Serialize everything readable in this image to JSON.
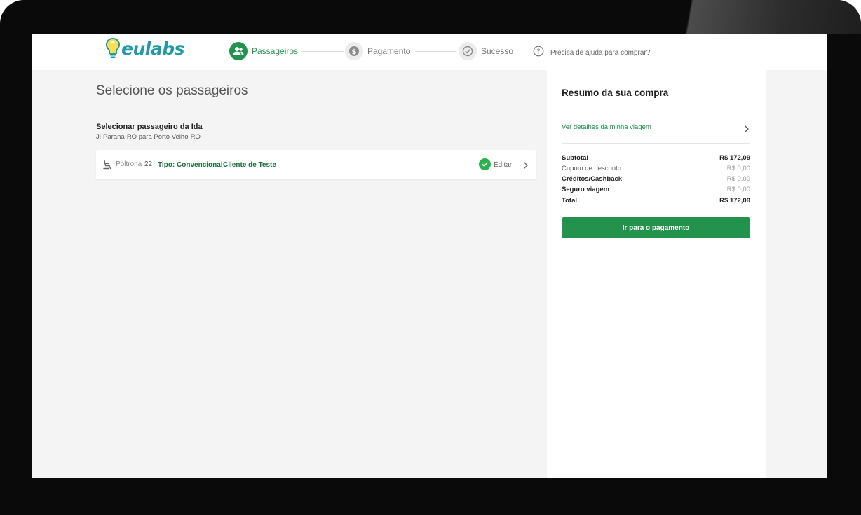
{
  "brand": {
    "logo_text": "eulabs"
  },
  "steps": [
    {
      "label": "Passageiros",
      "active": true
    },
    {
      "label": "Pagamento",
      "active": false
    },
    {
      "label": "Sucesso",
      "active": false
    }
  ],
  "help": {
    "label": "Precisa de ajuda para comprar?"
  },
  "main": {
    "title": "Selecione os passageiros",
    "section_title": "Selecionar passageiro da Ida",
    "route": "Ji-Paraná-RO para Porto Velho-RO",
    "passenger": {
      "seat_label": "Poltrona",
      "seat_number": "22",
      "type": "Tipo: Convencional",
      "name": "Cliente de Teste",
      "edit_label": "Editar"
    }
  },
  "summary": {
    "title": "Resumo da sua compra",
    "details_link": "Ver detalhes da minha viagem",
    "rows": [
      {
        "label": "Subtotal",
        "value": "R$ 172,09",
        "bold": true
      },
      {
        "label": "Cupom de desconto",
        "value": "R$ 0,00",
        "bold": false
      },
      {
        "label": "Créditos/Cashback",
        "value": "R$ 0,00",
        "bold": true
      },
      {
        "label": "Seguro viagem",
        "value": "R$ 0,00",
        "bold": true
      },
      {
        "label": "Total",
        "value": "R$ 172,09",
        "bold": true
      }
    ],
    "pay_button": "Ir para o pagamento"
  },
  "colors": {
    "accent": "#22924d",
    "brand_teal": "#1f9aa6",
    "check_green": "#2bb24c"
  },
  "icons": {
    "step_passageiros": "users-icon",
    "step_pagamento": "dollar-icon",
    "step_sucesso": "check-circle-icon",
    "help": "question-icon",
    "seat": "seat-icon",
    "edit_status": "check-icon",
    "chevron": "chevron-right-icon"
  }
}
